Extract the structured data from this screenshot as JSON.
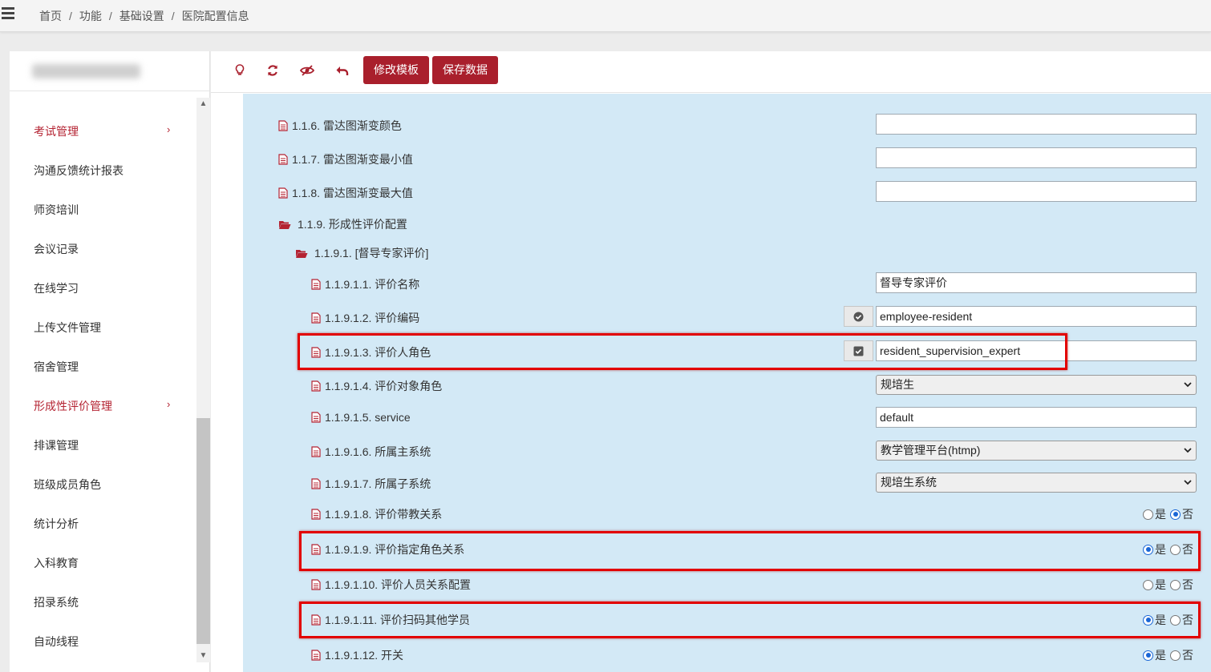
{
  "breadcrumb": [
    "首页",
    "功能",
    "基础设置",
    "医院配置信息"
  ],
  "sidebar": {
    "items": [
      {
        "label": "考试管理",
        "active": true,
        "has_arrow": true
      },
      {
        "label": "沟通反馈统计报表"
      },
      {
        "label": "师资培训"
      },
      {
        "label": "会议记录"
      },
      {
        "label": "在线学习"
      },
      {
        "label": "上传文件管理"
      },
      {
        "label": "宿舍管理"
      },
      {
        "label": "形成性评价管理",
        "active": true,
        "has_arrow": true
      },
      {
        "label": "排课管理"
      },
      {
        "label": "班级成员角色"
      },
      {
        "label": "统计分析"
      },
      {
        "label": "入科教育"
      },
      {
        "label": "招录系统"
      },
      {
        "label": "自动线程"
      }
    ],
    "arrow": "›"
  },
  "toolbar": {
    "icons": [
      "lightbulb-icon",
      "refresh-icon",
      "eye-slash-icon",
      "undo-icon"
    ],
    "edit_template_label": "修改模板",
    "save_data_label": "保存数据"
  },
  "colors": {
    "accent": "#a91f2c",
    "content_bg": "#d3e9f6",
    "highlight": "#e20000",
    "radio_on": "#1a66d6"
  },
  "config": {
    "r116": {
      "label": "1.1.6. 雷达图渐变颜色",
      "value": ""
    },
    "r117": {
      "label": "1.1.7. 雷达图渐变最小值",
      "value": ""
    },
    "r118": {
      "label": "1.1.8. 雷达图渐变最大值",
      "value": ""
    },
    "r119": {
      "label": "1.1.9. 形成性评价配置"
    },
    "r1191": {
      "label": "1.1.9.1. [督导专家评价]"
    },
    "r11911": {
      "label": "1.1.9.1.1. 评价名称",
      "value": "督导专家评价"
    },
    "r11912": {
      "label": "1.1.9.1.2. 评价编码",
      "value": "employee-resident"
    },
    "r11913": {
      "label": "1.1.9.1.3. 评价人角色",
      "value": "resident_supervision_expert"
    },
    "r11914": {
      "label": "1.1.9.1.4. 评价对象角色",
      "value": "规培生"
    },
    "r11915": {
      "label": "1.1.9.1.5. service",
      "value": "default"
    },
    "r11916": {
      "label": "1.1.9.1.6. 所属主系统",
      "value": "教学管理平台(htmp)"
    },
    "r11917": {
      "label": "1.1.9.1.7. 所属子系统",
      "value": "规培生系统"
    },
    "r11918": {
      "label": "1.1.9.1.8. 评价带教关系",
      "selected": "否"
    },
    "r11919": {
      "label": "1.1.9.1.9. 评价指定角色关系",
      "selected": "是"
    },
    "r119110": {
      "label": "1.1.9.1.10. 评价人员关系配置",
      "selected": "none"
    },
    "r119111": {
      "label": "1.1.9.1.11. 评价扫码其他学员",
      "selected": "是"
    },
    "r119112": {
      "label": "1.1.9.1.12. 开关",
      "selected": "是"
    }
  },
  "radio": {
    "yes": "是",
    "no": "否"
  }
}
